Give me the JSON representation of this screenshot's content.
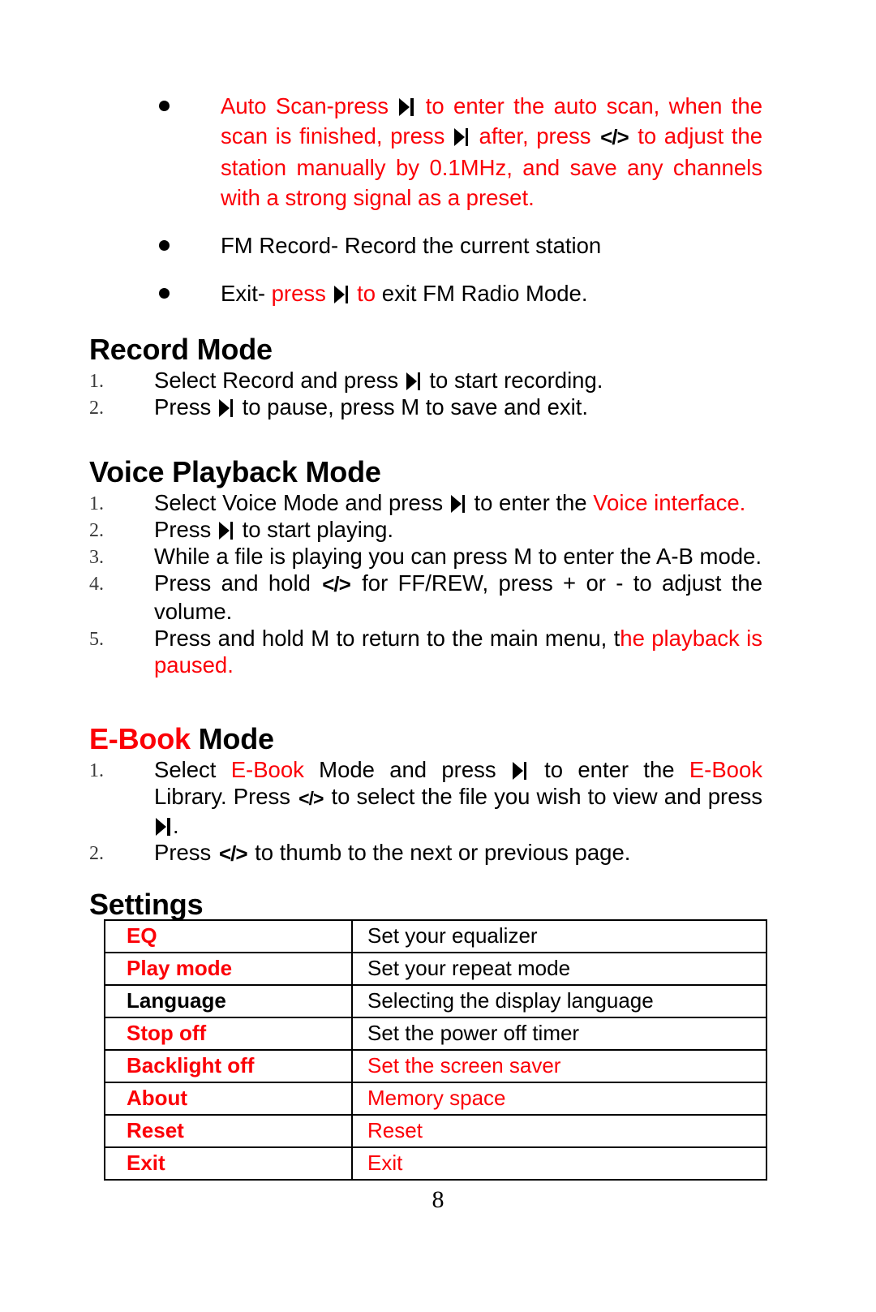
{
  "document": {
    "page_number": "8",
    "accent_color": "#fb0007",
    "text_color": "#000000"
  },
  "icons": {
    "play_pause": "play-skip-icon",
    "prev_next": "</>"
  },
  "fm_bullets": [
    {
      "id": "auto-scan",
      "segments": [
        {
          "text": "Auto Scan-press ",
          "color": "red"
        },
        {
          "icon": "play"
        },
        {
          "text": " to enter the auto scan, when the scan is finished, press ",
          "color": "red"
        },
        {
          "icon": "play"
        },
        {
          "text": " after, press ",
          "color": "red"
        },
        {
          "icon": "code"
        },
        {
          "text": " to adjust the station manually by 0.1MHz, and save any channels with a strong signal as a preset.",
          "color": "red"
        }
      ]
    },
    {
      "id": "fm-record",
      "segments": [
        {
          "text": "FM Record- Record the current station",
          "color": "black"
        }
      ]
    },
    {
      "id": "fm-exit",
      "segments": [
        {
          "text": "Exit- ",
          "color": "black"
        },
        {
          "text": "press ",
          "color": "red"
        },
        {
          "icon": "play"
        },
        {
          "text": " to ",
          "color": "red"
        },
        {
          "text": "exit FM Radio Mode.",
          "color": "black"
        }
      ]
    }
  ],
  "sections": [
    {
      "id": "record-mode",
      "heading": [
        {
          "text": "Record Mode",
          "color": "black"
        }
      ],
      "items": [
        {
          "marker": "1.",
          "segments": [
            {
              "text": "Select Record and press ",
              "color": "black"
            },
            {
              "icon": "play"
            },
            {
              "text": " to start recording.",
              "color": "black"
            }
          ]
        },
        {
          "marker": "2.",
          "segments": [
            {
              "text": "Press ",
              "color": "black"
            },
            {
              "icon": "play"
            },
            {
              "text": " to pause, press M to save and exit.",
              "color": "black"
            }
          ]
        }
      ]
    },
    {
      "id": "voice-playback-mode",
      "heading": [
        {
          "text": "Voice Playback Mode",
          "color": "black"
        }
      ],
      "items": [
        {
          "marker": "1.",
          "segments": [
            {
              "text": "Select Voice Mode and press ",
              "color": "black"
            },
            {
              "icon": "play"
            },
            {
              "text": "  to enter the ",
              "color": "black"
            },
            {
              "text": "Voice interface.",
              "color": "red"
            }
          ]
        },
        {
          "marker": "2.",
          "segments": [
            {
              "text": "Press ",
              "color": "black"
            },
            {
              "icon": "play"
            },
            {
              "text": " to start playing.",
              "color": "black"
            }
          ]
        },
        {
          "marker": "3.",
          "segments": [
            {
              "text": "While a file is playing you can press M to enter the A-B mode.",
              "color": "black"
            }
          ]
        },
        {
          "marker": "4.",
          "segments": [
            {
              "text": "Press and hold ",
              "color": "black"
            },
            {
              "icon": "code"
            },
            {
              "text": " for FF/REW, press + or - to adjust the volume.",
              "color": "black"
            }
          ]
        },
        {
          "marker": "5.",
          "segments": [
            {
              "text": "Press and hold M to return to the main menu, t",
              "color": "black"
            },
            {
              "text": "he playback is paused.",
              "color": "red"
            }
          ]
        }
      ]
    },
    {
      "id": "e-book-mode",
      "heading": [
        {
          "text": "E-Book",
          "color": "red"
        },
        {
          "text": " Mode",
          "color": "black"
        }
      ],
      "items": [
        {
          "marker": "1.",
          "segments": [
            {
              "text": "Select ",
              "color": "black"
            },
            {
              "text": "E-Book",
              "color": "red"
            },
            {
              "text": " Mode and press ",
              "color": "black"
            },
            {
              "icon": "play"
            },
            {
              "text": "  to enter the ",
              "color": "black"
            },
            {
              "text": "E-Book",
              "color": "red"
            },
            {
              "text": " Library. Press ",
              "color": "black"
            },
            {
              "icon": "code-small"
            },
            {
              "text": " to select the file you wish to view and press ",
              "color": "black"
            },
            {
              "icon": "play"
            },
            {
              "text": ".",
              "color": "black"
            }
          ]
        },
        {
          "marker": "2.",
          "segments": [
            {
              "text": "Press ",
              "color": "black"
            },
            {
              "icon": "code"
            },
            {
              "text": " to thumb to the next or previous page.",
              "color": "black"
            }
          ]
        }
      ]
    }
  ],
  "settings": {
    "heading": "Settings",
    "rows": [
      {
        "label": "EQ",
        "label_color": "red",
        "desc": "Set your equalizer",
        "desc_color": "black"
      },
      {
        "label": "Play mode",
        "label_color": "red",
        "desc": "Set your repeat mode",
        "desc_color": "black"
      },
      {
        "label": "Language",
        "label_color": "black",
        "desc": "Selecting the display language",
        "desc_color": "black"
      },
      {
        "label": "Stop off",
        "label_color": "red",
        "desc": "Set the power off timer",
        "desc_color": "black"
      },
      {
        "label": "Backlight off",
        "label_color": "red",
        "desc": "Set the screen saver",
        "desc_color": "red"
      },
      {
        "label": "About",
        "label_color": "red",
        "desc": "Memory space",
        "desc_color": "red"
      },
      {
        "label": "Reset",
        "label_color": "red",
        "desc": "Reset",
        "desc_color": "red"
      },
      {
        "label": "Exit",
        "label_color": "red",
        "desc": "Exit",
        "desc_color": "red"
      }
    ]
  }
}
